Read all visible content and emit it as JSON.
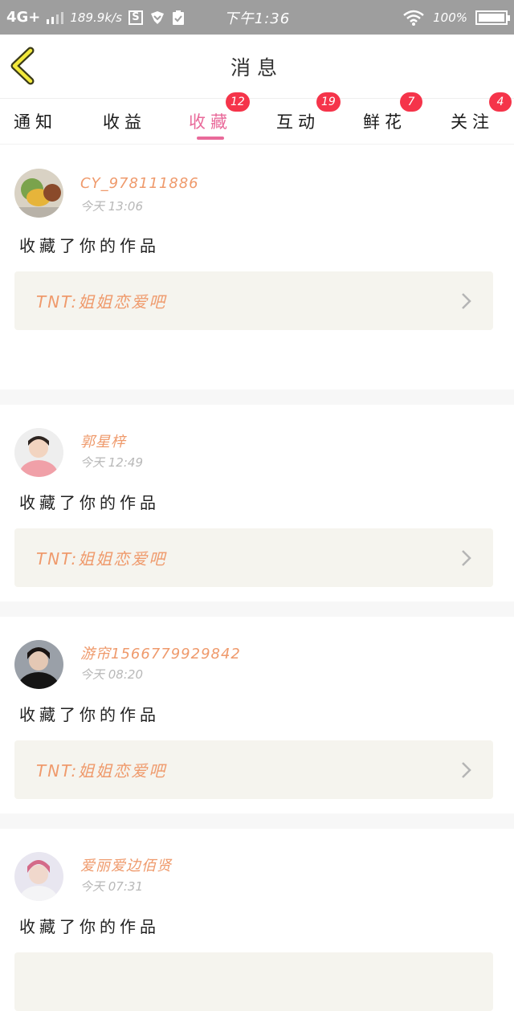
{
  "status_bar": {
    "network": "4G+",
    "speed": "189.9k/s",
    "s_label": "S",
    "time": "下午1:36",
    "battery": "100%",
    "battery_level": 1.0
  },
  "header": {
    "title": "消息",
    "back_icon": "chevron-left-icon"
  },
  "tabs": [
    {
      "label": "通知",
      "badge": ""
    },
    {
      "label": "收益",
      "badge": ""
    },
    {
      "label": "收藏",
      "badge": "12"
    },
    {
      "label": "互动",
      "badge": "19"
    },
    {
      "label": "鲜花",
      "badge": "7"
    },
    {
      "label": "关注",
      "badge": "4"
    }
  ],
  "active_tab": "收藏",
  "colors": {
    "accent": "#e96a9a",
    "badge": "#f5344a",
    "name": "#ef9a6c",
    "card_bg": "#f5f4ee"
  },
  "items": [
    {
      "username": "CY_978111886",
      "time": "今天 13:06",
      "action": "收藏了你的作品",
      "work": "TNT:姐姐恋爱吧"
    },
    {
      "username": "郭星梓",
      "time": "今天 12:49",
      "action": "收藏了你的作品",
      "work": "TNT:姐姐恋爱吧"
    },
    {
      "username": "游帘15667799298​42",
      "time": "今天 08:20",
      "action": "收藏了你的作品",
      "work": "TNT:姐姐恋爱吧"
    },
    {
      "username": "爱丽爱边佰贤",
      "time": "今天 07:31",
      "action": "收藏了你的作品",
      "work": ""
    }
  ]
}
